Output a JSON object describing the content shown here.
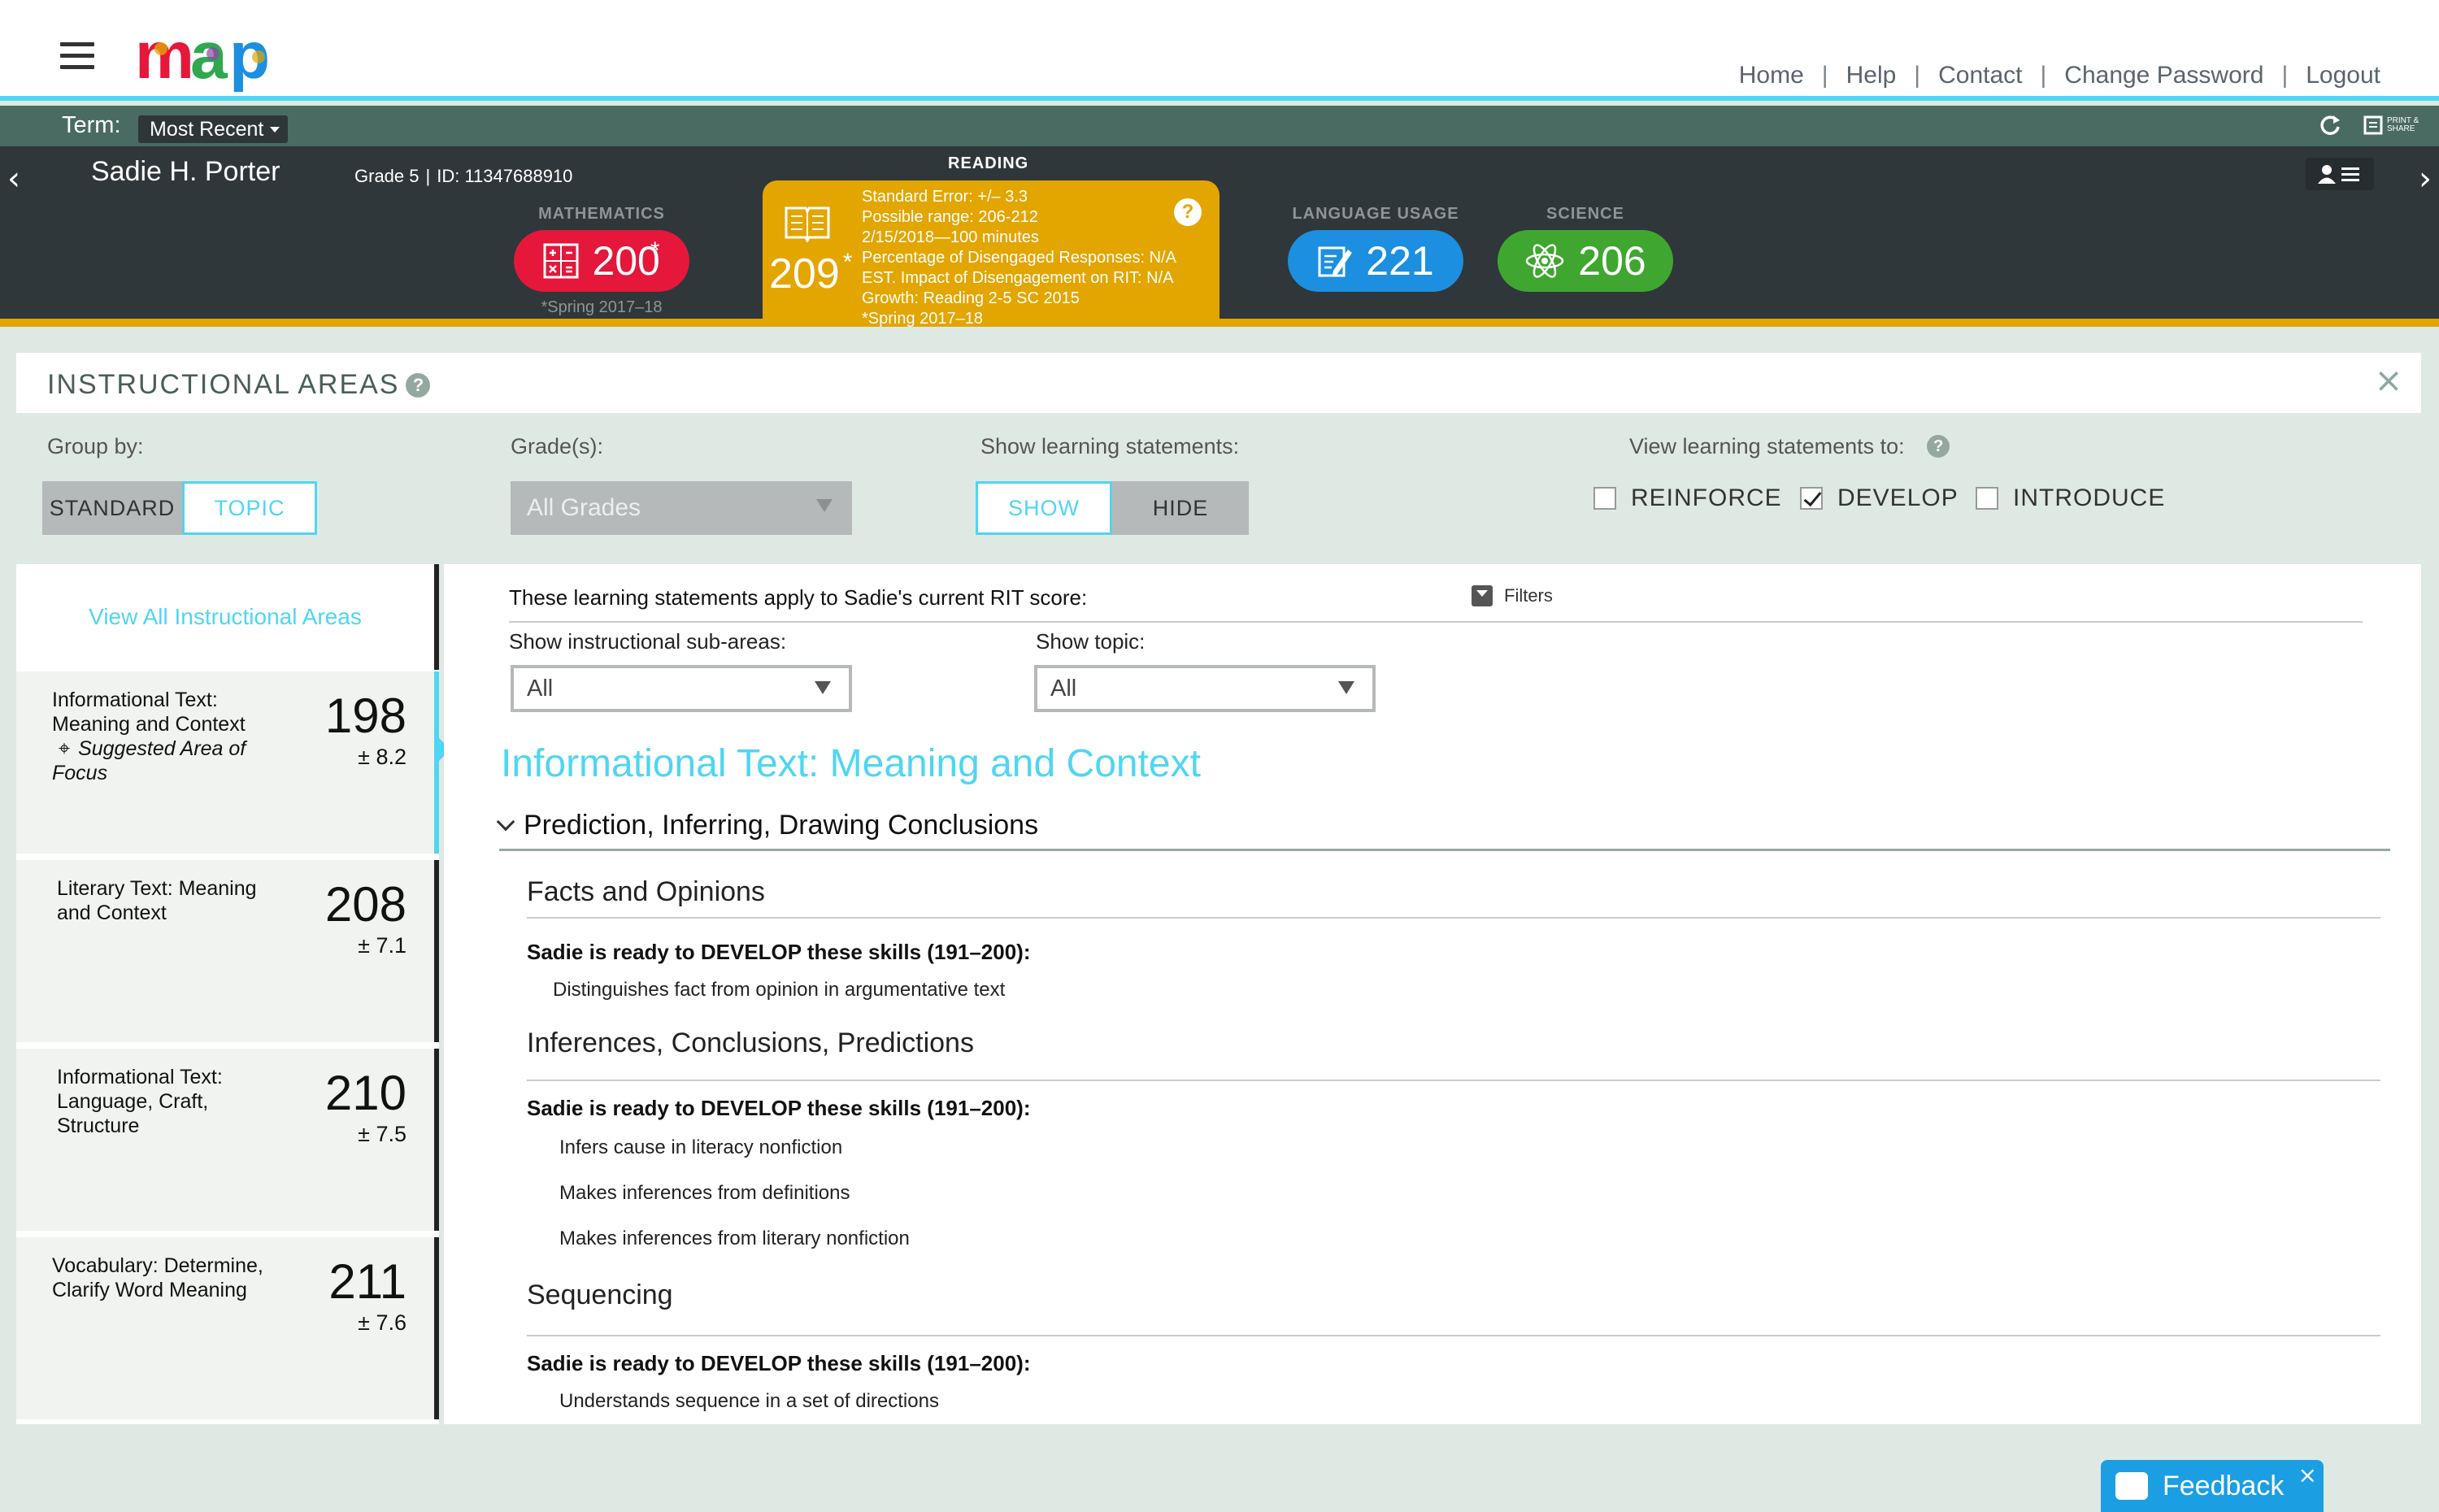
{
  "nav": {
    "links": [
      "Home",
      "Help",
      "Contact",
      "Change Password",
      "Logout"
    ]
  },
  "term": {
    "label": "Term:",
    "selected": "Most Recent",
    "print_label": "PRINT & SHARE"
  },
  "student": {
    "name": "Sadie H. Porter",
    "grade": "Grade 5",
    "id": "ID: 11347688910"
  },
  "subjects": {
    "math": {
      "label": "MATHEMATICS",
      "score": "200",
      "mark": "*",
      "foot": "*Spring 2017–18",
      "color": "#e5173a"
    },
    "reading": {
      "label": "READING",
      "score": "209",
      "mark": "*",
      "details": [
        "Standard Error: +/– 3.3",
        "Possible range: 206-212",
        "2/15/2018—100 minutes",
        "Percentage of Disengaged Responses: N/A",
        "EST. Impact of Disengagement on RIT: N/A",
        "Growth: Reading 2-5 SC 2015",
        "*Spring 2017–18"
      ],
      "color": "#e3a500"
    },
    "language": {
      "label": "LANGUAGE USAGE",
      "score": "221",
      "color": "#1c8fe0"
    },
    "science": {
      "label": "SCIENCE",
      "score": "206",
      "color": "#3fa72f"
    }
  },
  "ia": {
    "title": "INSTRUCTIONAL AREAS",
    "help": "?"
  },
  "controls": {
    "group_by_label": "Group by:",
    "group_by": [
      "STANDARD",
      "TOPIC"
    ],
    "grades_label": "Grade(s):",
    "grades_value": "All Grades",
    "show_label": "Show learning statements:",
    "show_options": [
      "SHOW",
      "HIDE"
    ],
    "view_label": "View learning statements to:",
    "view_options": [
      {
        "label": "REINFORCE",
        "checked": false
      },
      {
        "label": "DEVELOP",
        "checked": true
      },
      {
        "label": "INTRODUCE",
        "checked": false
      }
    ]
  },
  "sidebar": {
    "view_all": "View All Instructional Areas",
    "areas": [
      {
        "name": "Informational Text: Meaning and Context",
        "focus": "Suggested Area of Focus",
        "score": "198",
        "error": "± 8.2"
      },
      {
        "name": "Literary Text: Meaning and Context",
        "score": "208",
        "error": "± 7.1"
      },
      {
        "name": "Informational Text: Language, Craft, Structure",
        "score": "210",
        "error": "± 7.5"
      },
      {
        "name": "Vocabulary: Determine, Clarify Word Meaning",
        "score": "211",
        "error": "± 7.6"
      }
    ]
  },
  "main": {
    "statement_title": "These learning statements apply to Sadie's current RIT score:",
    "filters_label": "Filters",
    "subareas_label": "Show instructional sub-areas:",
    "subareas_value": "All",
    "topic_label": "Show topic:",
    "topic_value": "All",
    "area_heading": "Informational Text: Meaning and Context",
    "group_heading": "Prediction, Inferring, Drawing Conclusions",
    "topics": [
      {
        "name": "Facts and Opinions",
        "ready": "Sadie is ready to DEVELOP these skills (191–200):",
        "skills": [
          "Distinguishes fact from opinion in argumentative text"
        ]
      },
      {
        "name": "Inferences, Conclusions, Predictions",
        "ready": "Sadie is ready to DEVELOP these skills (191–200):",
        "skills": [
          "Infers cause in literacy nonfiction",
          "Makes inferences from definitions",
          "Makes inferences from literary nonfiction"
        ]
      },
      {
        "name": "Sequencing",
        "ready": "Sadie is ready to DEVELOP these skills (191–200):",
        "skills": [
          "Understands sequence in a set of directions"
        ]
      }
    ]
  },
  "feedback": {
    "label": "Feedback"
  }
}
